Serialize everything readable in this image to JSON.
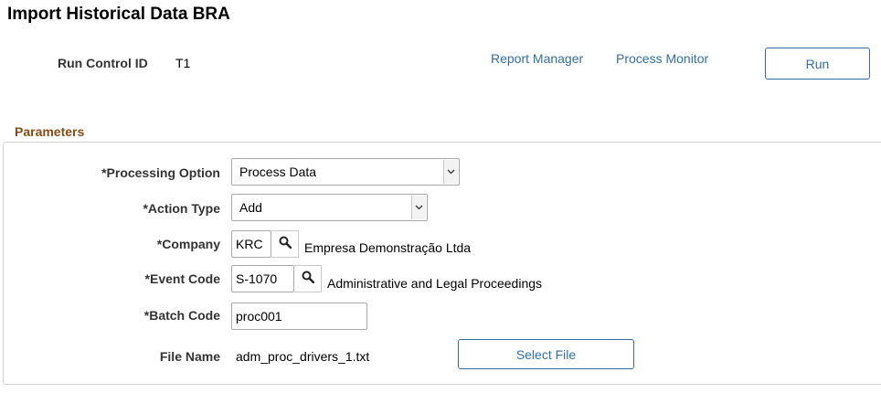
{
  "page": {
    "title": "Import Historical Data BRA"
  },
  "run_control": {
    "label": "Run Control ID",
    "value": "T1"
  },
  "links": {
    "report_manager": "Report Manager",
    "process_monitor": "Process Monitor"
  },
  "run_button": {
    "label": "Run"
  },
  "parameters": {
    "title": "Parameters",
    "processing_option": {
      "label": "*Processing Option",
      "value": "Process Data"
    },
    "action_type": {
      "label": "*Action Type",
      "value": "Add"
    },
    "company": {
      "label": "*Company",
      "value": "KRC",
      "description": "Empresa Demonstração Ltda"
    },
    "event_code": {
      "label": "*Event Code",
      "value": "S-1070",
      "description": "Administrative and Legal Proceedings"
    },
    "batch_code": {
      "label": "*Batch Code",
      "value": "proc001"
    },
    "file_name": {
      "label": "File Name",
      "value": "adm_proc_drivers_1.txt"
    },
    "select_file_button": {
      "label": "Select File"
    }
  },
  "icons": {
    "lookup": "search-icon",
    "dropdown": "chevron-down-icon"
  },
  "colors": {
    "link": "#2f6ea8",
    "section_title": "#8a4b12",
    "border": "#d0d0d0"
  }
}
